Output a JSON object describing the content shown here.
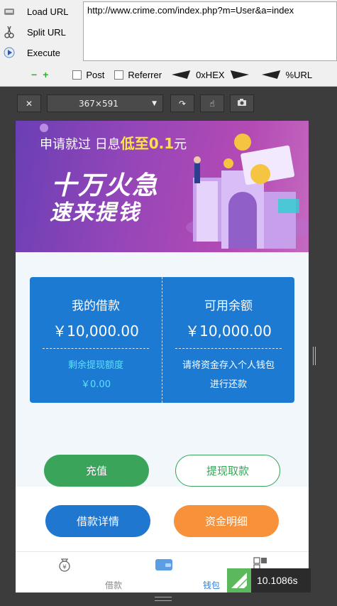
{
  "hackbar": {
    "load_url": "Load URL",
    "split_url": "Split URL",
    "execute": "Execute",
    "url_value": "http://www.crime.com/index.php?m=User&a=index",
    "post_label": "Post",
    "referrer_label": "Referrer",
    "hex_label": "0xHEX",
    "url_label": "%URL"
  },
  "devtools": {
    "dimensions": "367×591"
  },
  "banner": {
    "line_prefix": "申请就过 日息",
    "line_highlight": "低至0.1",
    "line_suffix": "元",
    "slogan1": "十万火急",
    "slogan2": "速来提钱"
  },
  "card": {
    "left_title": "我的借款",
    "left_amount": "￥10,000.00",
    "left_sub_label": "剩余提现额度",
    "left_sub_value": "￥0.00",
    "right_title": "可用余额",
    "right_amount": "￥10,000.00",
    "right_sub1": "请将资金存入个人钱包",
    "right_sub2": "进行还款"
  },
  "buttons": {
    "recharge": "充值",
    "withdraw": "提现取款",
    "loan_detail": "借款详情",
    "fund_detail": "资金明细"
  },
  "tabs": [
    {
      "label": "借款"
    },
    {
      "label": "钱包"
    },
    {
      "label": ""
    }
  ],
  "timer": "10.1086s",
  "colors": {
    "card_blue": "#1c7ad3",
    "green": "#3aa55a",
    "orange": "#f7923a",
    "tab_active": "#2a7fd4",
    "sub_cyan": "#5ee0ff"
  }
}
